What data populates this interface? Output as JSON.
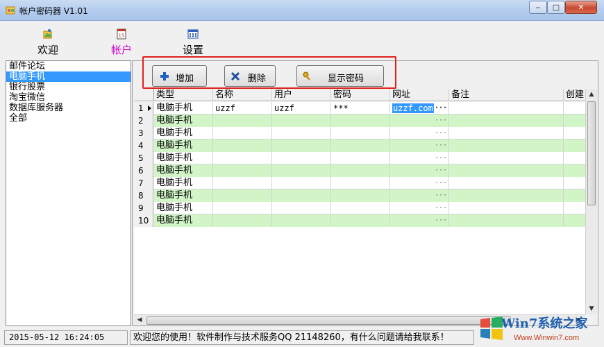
{
  "window": {
    "title": "帐户密码器 V1.01",
    "controls": {
      "minimize": "‒",
      "maximize": "□",
      "close": "✕"
    }
  },
  "nav": [
    {
      "label": "欢迎",
      "icon": "welcome-icon",
      "active": false
    },
    {
      "label": "帐户",
      "icon": "calendar-icon",
      "active": true
    },
    {
      "label": "设置",
      "icon": "settings-grid-icon",
      "active": false
    }
  ],
  "categories": [
    "邮件论坛",
    "电脑手机",
    "银行股票",
    "淘宝微信",
    "数据库服务器",
    "全部"
  ],
  "selected_category": "电脑手机",
  "toolbar": {
    "add": "增加",
    "delete": "删除",
    "show_password": "显示密码"
  },
  "table": {
    "columns": [
      "类型",
      "名称",
      "用户",
      "密码",
      "网址",
      "备注",
      "创建"
    ],
    "rows": [
      {
        "num": "1",
        "type": "电脑手机",
        "name": "uzzf",
        "user": "uzzf",
        "password": "***",
        "url": "uzzf.com",
        "note": ""
      },
      {
        "num": "2",
        "type": "电脑手机",
        "name": "",
        "user": "",
        "password": "",
        "url": "",
        "note": ""
      },
      {
        "num": "3",
        "type": "电脑手机",
        "name": "",
        "user": "",
        "password": "",
        "url": "",
        "note": ""
      },
      {
        "num": "4",
        "type": "电脑手机",
        "name": "",
        "user": "",
        "password": "",
        "url": "",
        "note": ""
      },
      {
        "num": "5",
        "type": "电脑手机",
        "name": "",
        "user": "",
        "password": "",
        "url": "",
        "note": ""
      },
      {
        "num": "6",
        "type": "电脑手机",
        "name": "",
        "user": "",
        "password": "",
        "url": "",
        "note": ""
      },
      {
        "num": "7",
        "type": "电脑手机",
        "name": "",
        "user": "",
        "password": "",
        "url": "",
        "note": ""
      },
      {
        "num": "8",
        "type": "电脑手机",
        "name": "",
        "user": "",
        "password": "",
        "url": "",
        "note": ""
      },
      {
        "num": "9",
        "type": "电脑手机",
        "name": "",
        "user": "",
        "password": "",
        "url": "",
        "note": ""
      },
      {
        "num": "10",
        "type": "电脑手机",
        "name": "",
        "user": "",
        "password": "",
        "url": "",
        "note": ""
      }
    ],
    "ellipsis": "···"
  },
  "status": {
    "datetime": "2015-05-12 16:24:05",
    "message": "欢迎您的使用！软件制作与技术服务QQ 21148260，有什么问题请给我联系！"
  },
  "watermark": {
    "text": "Win7系统之家",
    "url": "Www.Winwin7.com"
  },
  "colors": {
    "selection": "#3399ff",
    "alt_row": "#d2f5c8",
    "active_nav": "#d000d0",
    "highlight_box": "#e02020"
  }
}
